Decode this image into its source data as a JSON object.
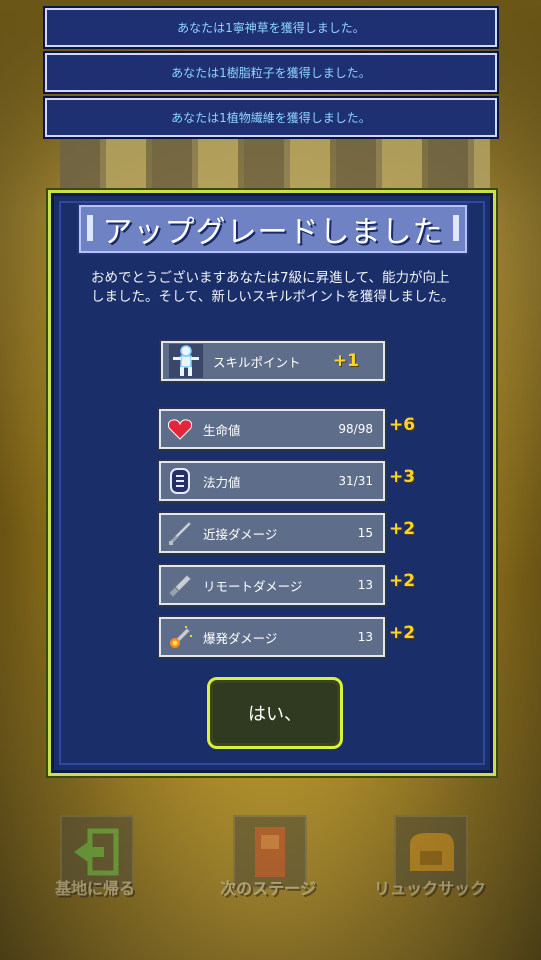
{
  "toasts": [
    "あなたは1寧神草を獲得しました。",
    "あなたは1樹脂粒子を獲得しました。",
    "あなたは1植物繊維を獲得しました。"
  ],
  "dialog": {
    "title": "アップグレードしました",
    "message": "おめでとうございますあなたは7級に昇進して、能力が向上しました。そして、新しいスキルポイントを獲得しました。",
    "skill_point": {
      "label": "スキルポイント",
      "bonus": "+1"
    },
    "stats": [
      {
        "label": "生命値",
        "value": "98/98",
        "bonus": "+6",
        "icon": "heart-icon"
      },
      {
        "label": "法力値",
        "value": "31/31",
        "bonus": "+3",
        "icon": "mana-icon"
      },
      {
        "label": "近接ダメージ",
        "value": "15",
        "bonus": "+2",
        "icon": "sword-icon"
      },
      {
        "label": "リモートダメージ",
        "value": "13",
        "bonus": "+2",
        "icon": "gun-icon"
      },
      {
        "label": "爆発ダメージ",
        "value": "13",
        "bonus": "+2",
        "icon": "explosion-icon"
      }
    ],
    "ok_label": "はい、"
  },
  "bottom": {
    "home": "基地に帰る",
    "next": "次のステージ",
    "bag": "リュックサック"
  },
  "colors": {
    "accent": "#d9f23c",
    "bonus": "#ffd42a",
    "panel": "#1a2f6a"
  }
}
